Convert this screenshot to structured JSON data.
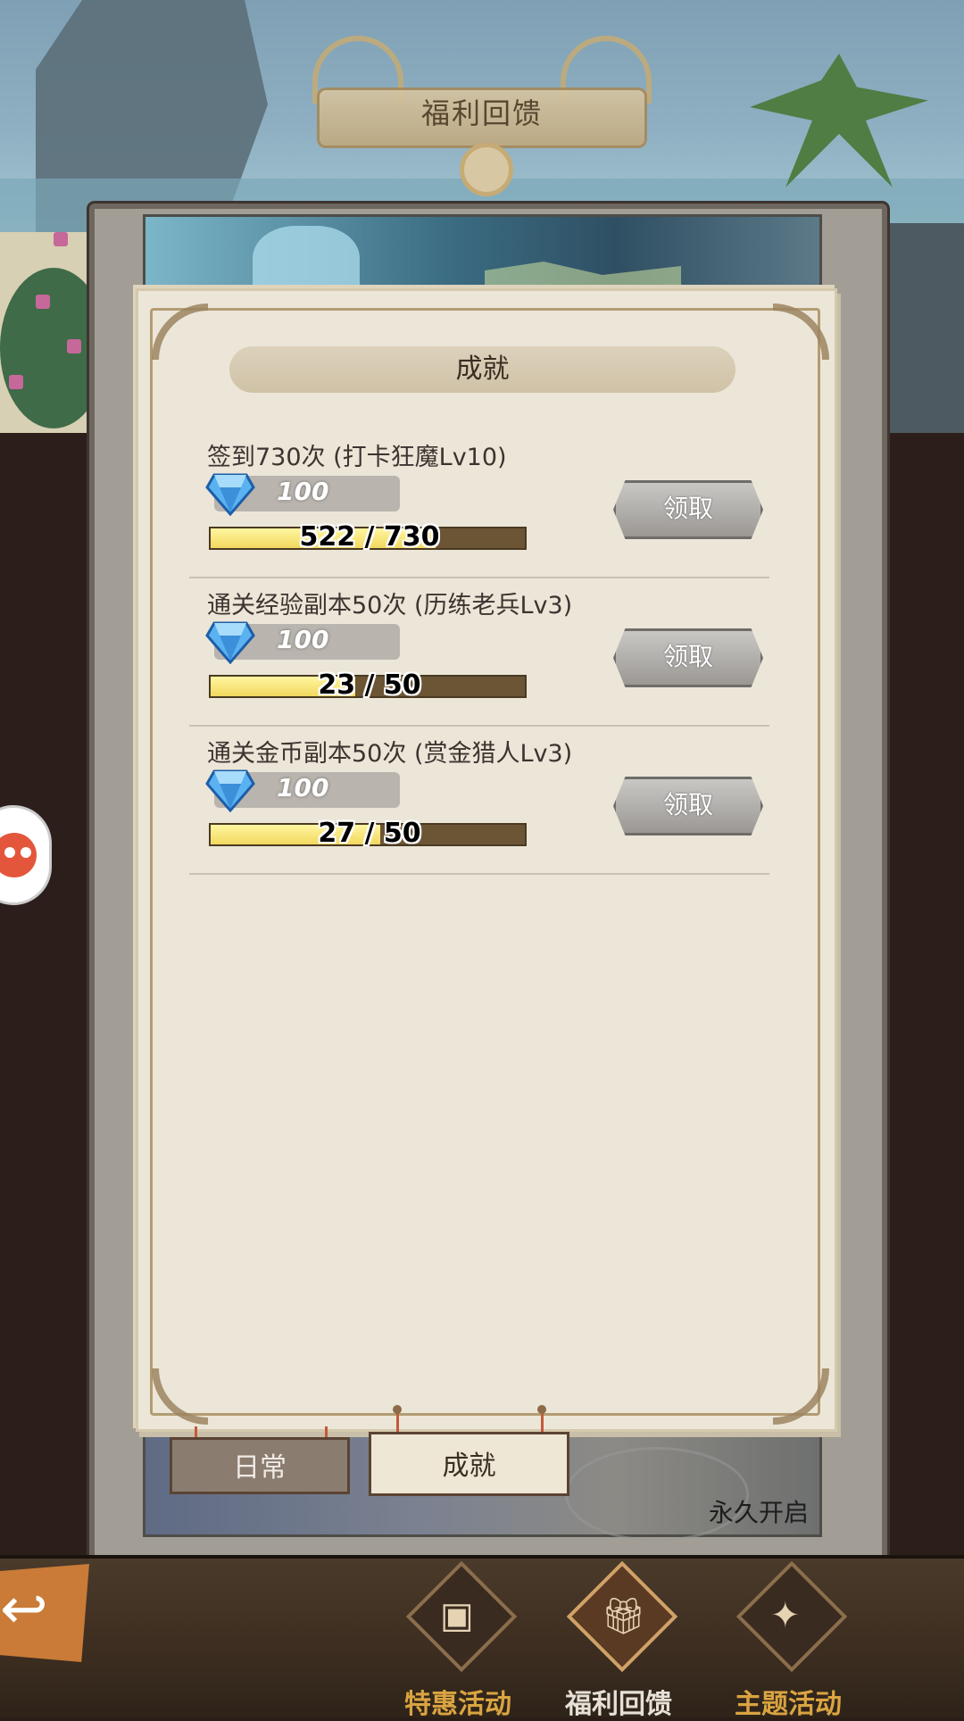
{
  "header": {
    "title": "福利回馈"
  },
  "banner": {
    "footer_text": "永久开启"
  },
  "section": {
    "title": "成就"
  },
  "achievements": [
    {
      "title": "签到730次  (打卡狂魔Lv10)",
      "reward_amount": "100",
      "progress_text": "522 / 730",
      "progress_fraction": 0.715,
      "claim_label": "领取"
    },
    {
      "title": "通关经验副本50次  (历练老兵Lv3)",
      "reward_amount": "100",
      "progress_text": "23 / 50",
      "progress_fraction": 0.46,
      "claim_label": "领取"
    },
    {
      "title": "通关金币副本50次  (赏金猎人Lv3)",
      "reward_amount": "100",
      "progress_text": "27 / 50",
      "progress_fraction": 0.54,
      "claim_label": "领取"
    }
  ],
  "tabs": [
    {
      "label": "日常",
      "active": false
    },
    {
      "label": "成就",
      "active": true
    }
  ],
  "bottom_nav": [
    {
      "label": "特惠活动",
      "icon": "treasure-chest-icon",
      "active": false,
      "color": "#d9a441"
    },
    {
      "label": "福利回馈",
      "icon": "gift-box-icon",
      "active": true,
      "color": "#e6e0d6"
    },
    {
      "label": "主题活动",
      "icon": "firework-icon",
      "active": false,
      "color": "#d9a441"
    }
  ],
  "icons": {
    "reward": "diamond-icon",
    "back": "back-arrow-icon",
    "side": "mascot-icon"
  }
}
